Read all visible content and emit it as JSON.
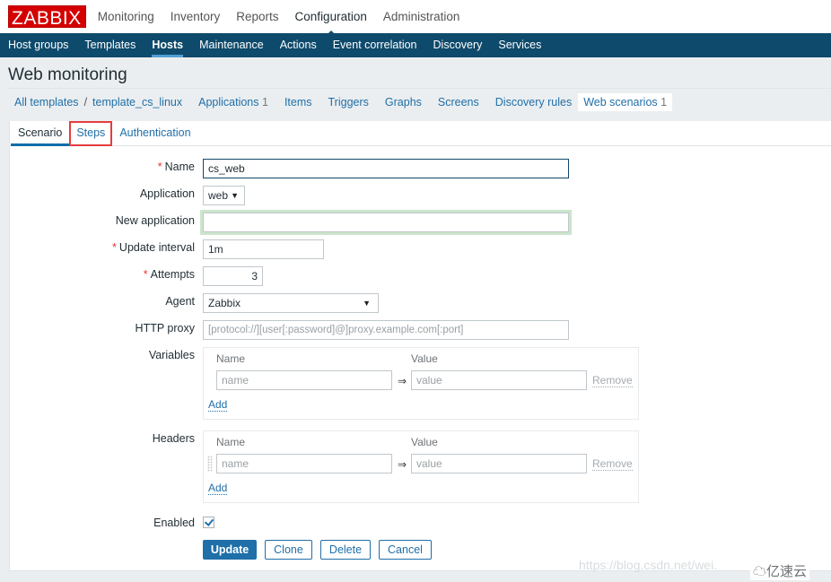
{
  "app": {
    "logo": "ZABBIX"
  },
  "top_nav": [
    {
      "label": "Monitoring",
      "active": false
    },
    {
      "label": "Inventory",
      "active": false
    },
    {
      "label": "Reports",
      "active": false
    },
    {
      "label": "Configuration",
      "active": true
    },
    {
      "label": "Administration",
      "active": false
    }
  ],
  "sub_nav": [
    {
      "label": "Host groups",
      "active": false
    },
    {
      "label": "Templates",
      "active": false
    },
    {
      "label": "Hosts",
      "active": true
    },
    {
      "label": "Maintenance",
      "active": false
    },
    {
      "label": "Actions",
      "active": false
    },
    {
      "label": "Event correlation",
      "active": false
    },
    {
      "label": "Discovery",
      "active": false
    },
    {
      "label": "Services",
      "active": false
    }
  ],
  "page_title": "Web monitoring",
  "breadcrumbs": {
    "all_templates": "All templates",
    "separator": "/",
    "template": "template_cs_linux",
    "applications": {
      "label": "Applications",
      "count": "1"
    },
    "items": "Items",
    "triggers": "Triggers",
    "graphs": "Graphs",
    "screens": "Screens",
    "discovery_rules": "Discovery rules",
    "web_scenarios": {
      "label": "Web scenarios",
      "count": "1"
    }
  },
  "tabs": [
    {
      "label": "Scenario",
      "active": true
    },
    {
      "label": "Steps",
      "active": false,
      "highlighted": true
    },
    {
      "label": "Authentication",
      "active": false
    }
  ],
  "form": {
    "name": {
      "label": "Name",
      "required": true,
      "value": "cs_web"
    },
    "application": {
      "label": "Application",
      "value": "web"
    },
    "new_application": {
      "label": "New application",
      "value": ""
    },
    "update_interval": {
      "label": "Update interval",
      "required": true,
      "value": "1m"
    },
    "attempts": {
      "label": "Attempts",
      "required": true,
      "value": "3"
    },
    "agent": {
      "label": "Agent",
      "value": "Zabbix"
    },
    "http_proxy": {
      "label": "HTTP proxy",
      "value": "",
      "placeholder": "[protocol://][user[:password]@]proxy.example.com[:port]"
    },
    "variables": {
      "label": "Variables",
      "col_name": "Name",
      "col_value": "Value",
      "rows": [
        {
          "name_placeholder": "name",
          "value_placeholder": "value",
          "arrow": "⇒",
          "remove": "Remove"
        }
      ],
      "add": "Add"
    },
    "headers": {
      "label": "Headers",
      "col_name": "Name",
      "col_value": "Value",
      "rows": [
        {
          "name_placeholder": "name",
          "value_placeholder": "value",
          "arrow": "⇒",
          "remove": "Remove"
        }
      ],
      "add": "Add"
    },
    "enabled": {
      "label": "Enabled",
      "checked": true
    },
    "buttons": {
      "update": "Update",
      "clone": "Clone",
      "delete": "Delete",
      "cancel": "Cancel"
    }
  },
  "watermark": {
    "url": "https://blog.csdn.net/wei.",
    "brand": "亿速云"
  },
  "colors": {
    "brand_red": "#d40000",
    "nav_blue": "#0e4a6b",
    "link_blue": "#1f6fa8",
    "highlight_red": "#e43d3d"
  }
}
